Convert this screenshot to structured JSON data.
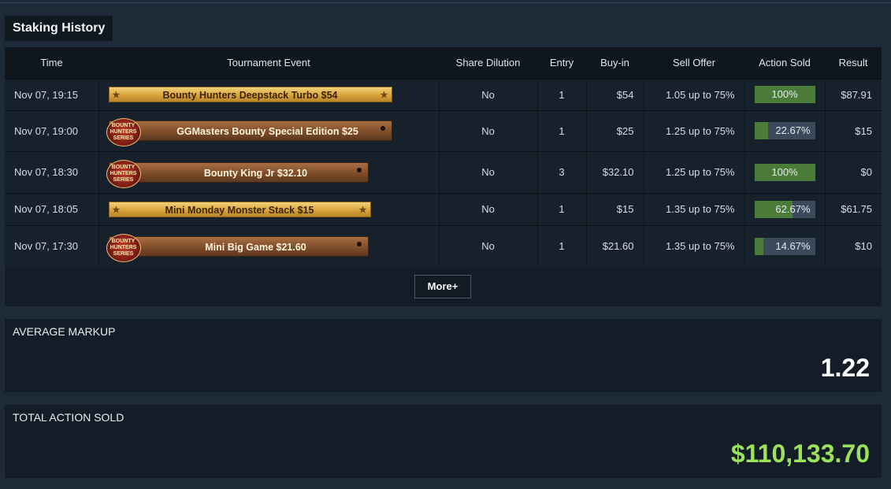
{
  "title": "Staking History",
  "columns": [
    "Time",
    "Tournament Event",
    "Share Dilution",
    "Entry",
    "Buy-in",
    "Sell Offer",
    "Action Sold",
    "Result"
  ],
  "rows": [
    {
      "time": "Nov 07, 19:15",
      "event": "Bounty Hunters Deepstack Turbo $54",
      "style": "gold",
      "dilution": "No",
      "entry": "1",
      "buyin": "$54",
      "offer": "1.05 up to 75%",
      "sold_pct": 100,
      "sold": "100%",
      "result": "$87.91"
    },
    {
      "time": "Nov 07, 19:00",
      "event": "GGMasters Bounty Special Edition $25",
      "style": "wood",
      "dilution": "No",
      "entry": "1",
      "buyin": "$25",
      "offer": "1.25 up to 75%",
      "sold_pct": 22.67,
      "sold": "22.67%",
      "result": "$15"
    },
    {
      "time": "Nov 07, 18:30",
      "event": "Bounty King Jr $32.10",
      "style": "wood",
      "dilution": "No",
      "entry": "3",
      "buyin": "$32.10",
      "offer": "1.25 up to 75%",
      "sold_pct": 100,
      "sold": "100%",
      "result": "$0"
    },
    {
      "time": "Nov 07, 18:05",
      "event": "Mini Monday Monster Stack $15",
      "style": "gold",
      "dilution": "No",
      "entry": "1",
      "buyin": "$15",
      "offer": "1.35 up to 75%",
      "sold_pct": 62.67,
      "sold": "62.67%",
      "result": "$61.75"
    },
    {
      "time": "Nov 07, 17:30",
      "event": "Mini Big Game $21.60",
      "style": "wood",
      "dilution": "No",
      "entry": "1",
      "buyin": "$21.60",
      "offer": "1.35 up to 75%",
      "sold_pct": 14.67,
      "sold": "14.67%",
      "result": "$10"
    }
  ],
  "logo_text": "BOUNTY HUNTERS SERIES",
  "more_label": "More+",
  "avg_markup": {
    "label": "AVERAGE MARKUP",
    "value": "1.22"
  },
  "total_sold": {
    "label": "TOTAL ACTION SOLD",
    "value": "$110,133.70",
    "color": "#9be25a"
  }
}
